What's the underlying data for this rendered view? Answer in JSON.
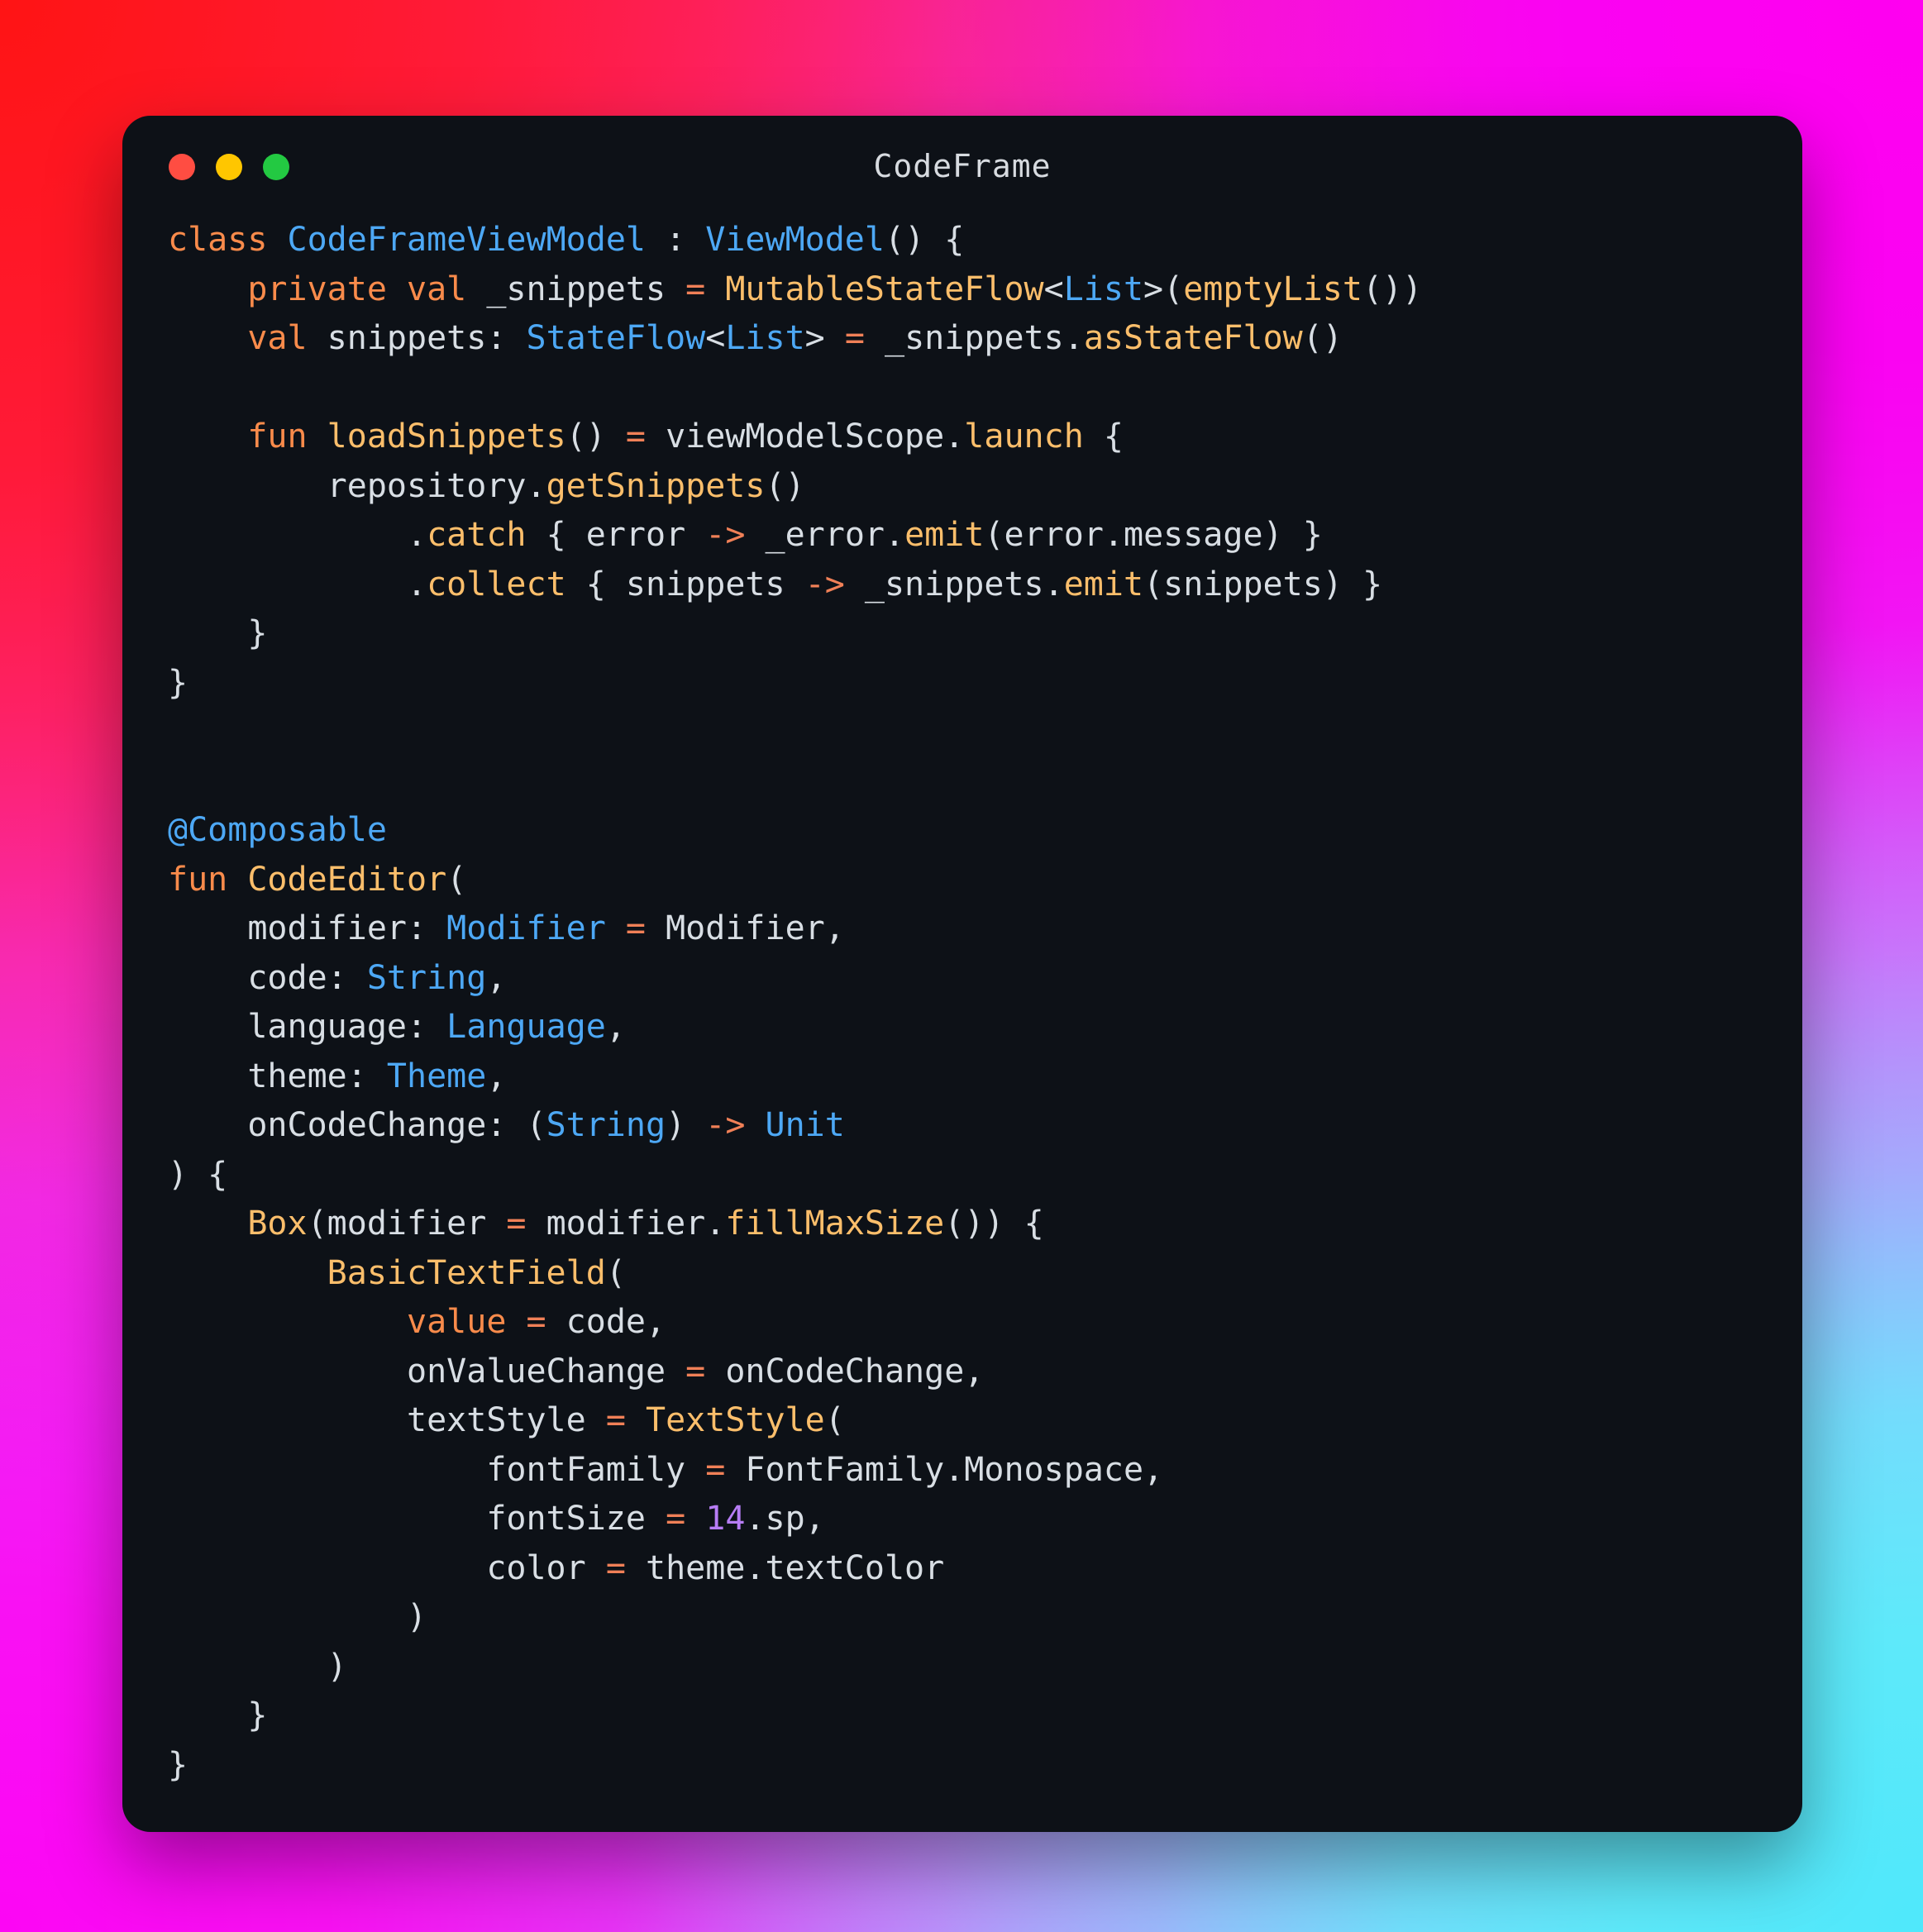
{
  "window": {
    "title": "CodeFrame",
    "background_color": "#0D1117",
    "corner_radius": "34px",
    "traffic_lights": [
      {
        "name": "close",
        "color": "#FF4D42"
      },
      {
        "name": "minimize",
        "color": "#FFC600"
      },
      {
        "name": "maximize",
        "color": "#23C942"
      }
    ]
  },
  "backdrop": {
    "top_left_color": "#FF1414",
    "top_right_color": "#FF00F0",
    "bottom_left_color": "#FC06F4",
    "bottom_right_color": "#4FE8FB",
    "mid_left_color": "#FF2390",
    "mid_right_color": "#C79BFB"
  },
  "theme": {
    "keyword_color": "#F98B4B",
    "type_color": "#4DA8F5",
    "function_color": "#FBBE6B",
    "operator_color": "#F08057",
    "number_color": "#B77DF5",
    "plain_color": "#D8DEE4"
  },
  "code": {
    "language": "Kotlin",
    "font_size": "40px",
    "lines": [
      [
        {
          "t": "class ",
          "c": "kw"
        },
        {
          "t": "CodeFrameViewModel",
          "c": "typ"
        },
        {
          "t": " : ",
          "c": "pl"
        },
        {
          "t": "ViewModel",
          "c": "typ"
        },
        {
          "t": "() {",
          "c": "pl"
        }
      ],
      [
        {
          "t": "    ",
          "c": "pl"
        },
        {
          "t": "private val ",
          "c": "kw"
        },
        {
          "t": "_snippets ",
          "c": "pl"
        },
        {
          "t": "= ",
          "c": "op"
        },
        {
          "t": "MutableStateFlow",
          "c": "fn"
        },
        {
          "t": "<",
          "c": "pl"
        },
        {
          "t": "List",
          "c": "typ"
        },
        {
          "t": ">(",
          "c": "pl"
        },
        {
          "t": "emptyList",
          "c": "fn"
        },
        {
          "t": "())",
          "c": "pl"
        }
      ],
      [
        {
          "t": "    ",
          "c": "pl"
        },
        {
          "t": "val ",
          "c": "kw"
        },
        {
          "t": "snippets: ",
          "c": "pl"
        },
        {
          "t": "StateFlow",
          "c": "typ"
        },
        {
          "t": "<",
          "c": "pl"
        },
        {
          "t": "List",
          "c": "typ"
        },
        {
          "t": "> ",
          "c": "pl"
        },
        {
          "t": "= ",
          "c": "op"
        },
        {
          "t": "_snippets.",
          "c": "pl"
        },
        {
          "t": "asStateFlow",
          "c": "fn"
        },
        {
          "t": "()",
          "c": "pl"
        }
      ],
      [
        {
          "t": "",
          "c": "pl"
        }
      ],
      [
        {
          "t": "    ",
          "c": "pl"
        },
        {
          "t": "fun ",
          "c": "kw"
        },
        {
          "t": "loadSnippets",
          "c": "fn"
        },
        {
          "t": "() ",
          "c": "pl"
        },
        {
          "t": "= ",
          "c": "op"
        },
        {
          "t": "viewModelScope.",
          "c": "pl"
        },
        {
          "t": "launch",
          "c": "fn"
        },
        {
          "t": " {",
          "c": "pl"
        }
      ],
      [
        {
          "t": "        repository.",
          "c": "pl"
        },
        {
          "t": "getSnippets",
          "c": "fn"
        },
        {
          "t": "()",
          "c": "pl"
        }
      ],
      [
        {
          "t": "            .",
          "c": "pl"
        },
        {
          "t": "catch",
          "c": "fn"
        },
        {
          "t": " { error ",
          "c": "pl"
        },
        {
          "t": "-> ",
          "c": "op"
        },
        {
          "t": "_error.",
          "c": "pl"
        },
        {
          "t": "emit",
          "c": "fn"
        },
        {
          "t": "(error.message) }",
          "c": "pl"
        }
      ],
      [
        {
          "t": "            .",
          "c": "pl"
        },
        {
          "t": "collect",
          "c": "fn"
        },
        {
          "t": " { snippets ",
          "c": "pl"
        },
        {
          "t": "-> ",
          "c": "op"
        },
        {
          "t": "_snippets.",
          "c": "pl"
        },
        {
          "t": "emit",
          "c": "fn"
        },
        {
          "t": "(snippets) }",
          "c": "pl"
        }
      ],
      [
        {
          "t": "    }",
          "c": "pl"
        }
      ],
      [
        {
          "t": "}",
          "c": "pl"
        }
      ],
      [
        {
          "t": "",
          "c": "pl"
        }
      ],
      [
        {
          "t": "",
          "c": "pl"
        }
      ],
      [
        {
          "t": "@Composable",
          "c": "typ"
        }
      ],
      [
        {
          "t": "fun ",
          "c": "kw"
        },
        {
          "t": "CodeEditor",
          "c": "fn"
        },
        {
          "t": "(",
          "c": "pl"
        }
      ],
      [
        {
          "t": "    modifier: ",
          "c": "pl"
        },
        {
          "t": "Modifier ",
          "c": "typ"
        },
        {
          "t": "= ",
          "c": "op"
        },
        {
          "t": "Modifier,",
          "c": "pl"
        }
      ],
      [
        {
          "t": "    code: ",
          "c": "pl"
        },
        {
          "t": "String",
          "c": "typ"
        },
        {
          "t": ",",
          "c": "pl"
        }
      ],
      [
        {
          "t": "    language: ",
          "c": "pl"
        },
        {
          "t": "Language",
          "c": "typ"
        },
        {
          "t": ",",
          "c": "pl"
        }
      ],
      [
        {
          "t": "    theme: ",
          "c": "pl"
        },
        {
          "t": "Theme",
          "c": "typ"
        },
        {
          "t": ",",
          "c": "pl"
        }
      ],
      [
        {
          "t": "    onCodeChange: (",
          "c": "pl"
        },
        {
          "t": "String",
          "c": "typ"
        },
        {
          "t": ") ",
          "c": "pl"
        },
        {
          "t": "-> ",
          "c": "op"
        },
        {
          "t": "Unit",
          "c": "typ"
        }
      ],
      [
        {
          "t": ") {",
          "c": "pl"
        }
      ],
      [
        {
          "t": "    ",
          "c": "pl"
        },
        {
          "t": "Box",
          "c": "fn"
        },
        {
          "t": "(modifier ",
          "c": "pl"
        },
        {
          "t": "= ",
          "c": "op"
        },
        {
          "t": "modifier.",
          "c": "pl"
        },
        {
          "t": "fillMaxSize",
          "c": "fn"
        },
        {
          "t": "()) {",
          "c": "pl"
        }
      ],
      [
        {
          "t": "        ",
          "c": "pl"
        },
        {
          "t": "BasicTextField",
          "c": "fn"
        },
        {
          "t": "(",
          "c": "pl"
        }
      ],
      [
        {
          "t": "            ",
          "c": "pl"
        },
        {
          "t": "value ",
          "c": "kw"
        },
        {
          "t": "= ",
          "c": "op"
        },
        {
          "t": "code,",
          "c": "pl"
        }
      ],
      [
        {
          "t": "            onValueChange ",
          "c": "pl"
        },
        {
          "t": "= ",
          "c": "op"
        },
        {
          "t": "onCodeChange,",
          "c": "pl"
        }
      ],
      [
        {
          "t": "            textStyle ",
          "c": "pl"
        },
        {
          "t": "= ",
          "c": "op"
        },
        {
          "t": "TextStyle",
          "c": "fn"
        },
        {
          "t": "(",
          "c": "pl"
        }
      ],
      [
        {
          "t": "                fontFamily ",
          "c": "pl"
        },
        {
          "t": "= ",
          "c": "op"
        },
        {
          "t": "FontFamily.Monospace,",
          "c": "pl"
        }
      ],
      [
        {
          "t": "                fontSize ",
          "c": "pl"
        },
        {
          "t": "= ",
          "c": "op"
        },
        {
          "t": "14",
          "c": "num"
        },
        {
          "t": ".sp,",
          "c": "pl"
        }
      ],
      [
        {
          "t": "                color ",
          "c": "pl"
        },
        {
          "t": "= ",
          "c": "op"
        },
        {
          "t": "theme.textColor",
          "c": "pl"
        }
      ],
      [
        {
          "t": "            )",
          "c": "pl"
        }
      ],
      [
        {
          "t": "        )",
          "c": "pl"
        }
      ],
      [
        {
          "t": "    }",
          "c": "pl"
        }
      ],
      [
        {
          "t": "}",
          "c": "pl"
        }
      ]
    ]
  }
}
